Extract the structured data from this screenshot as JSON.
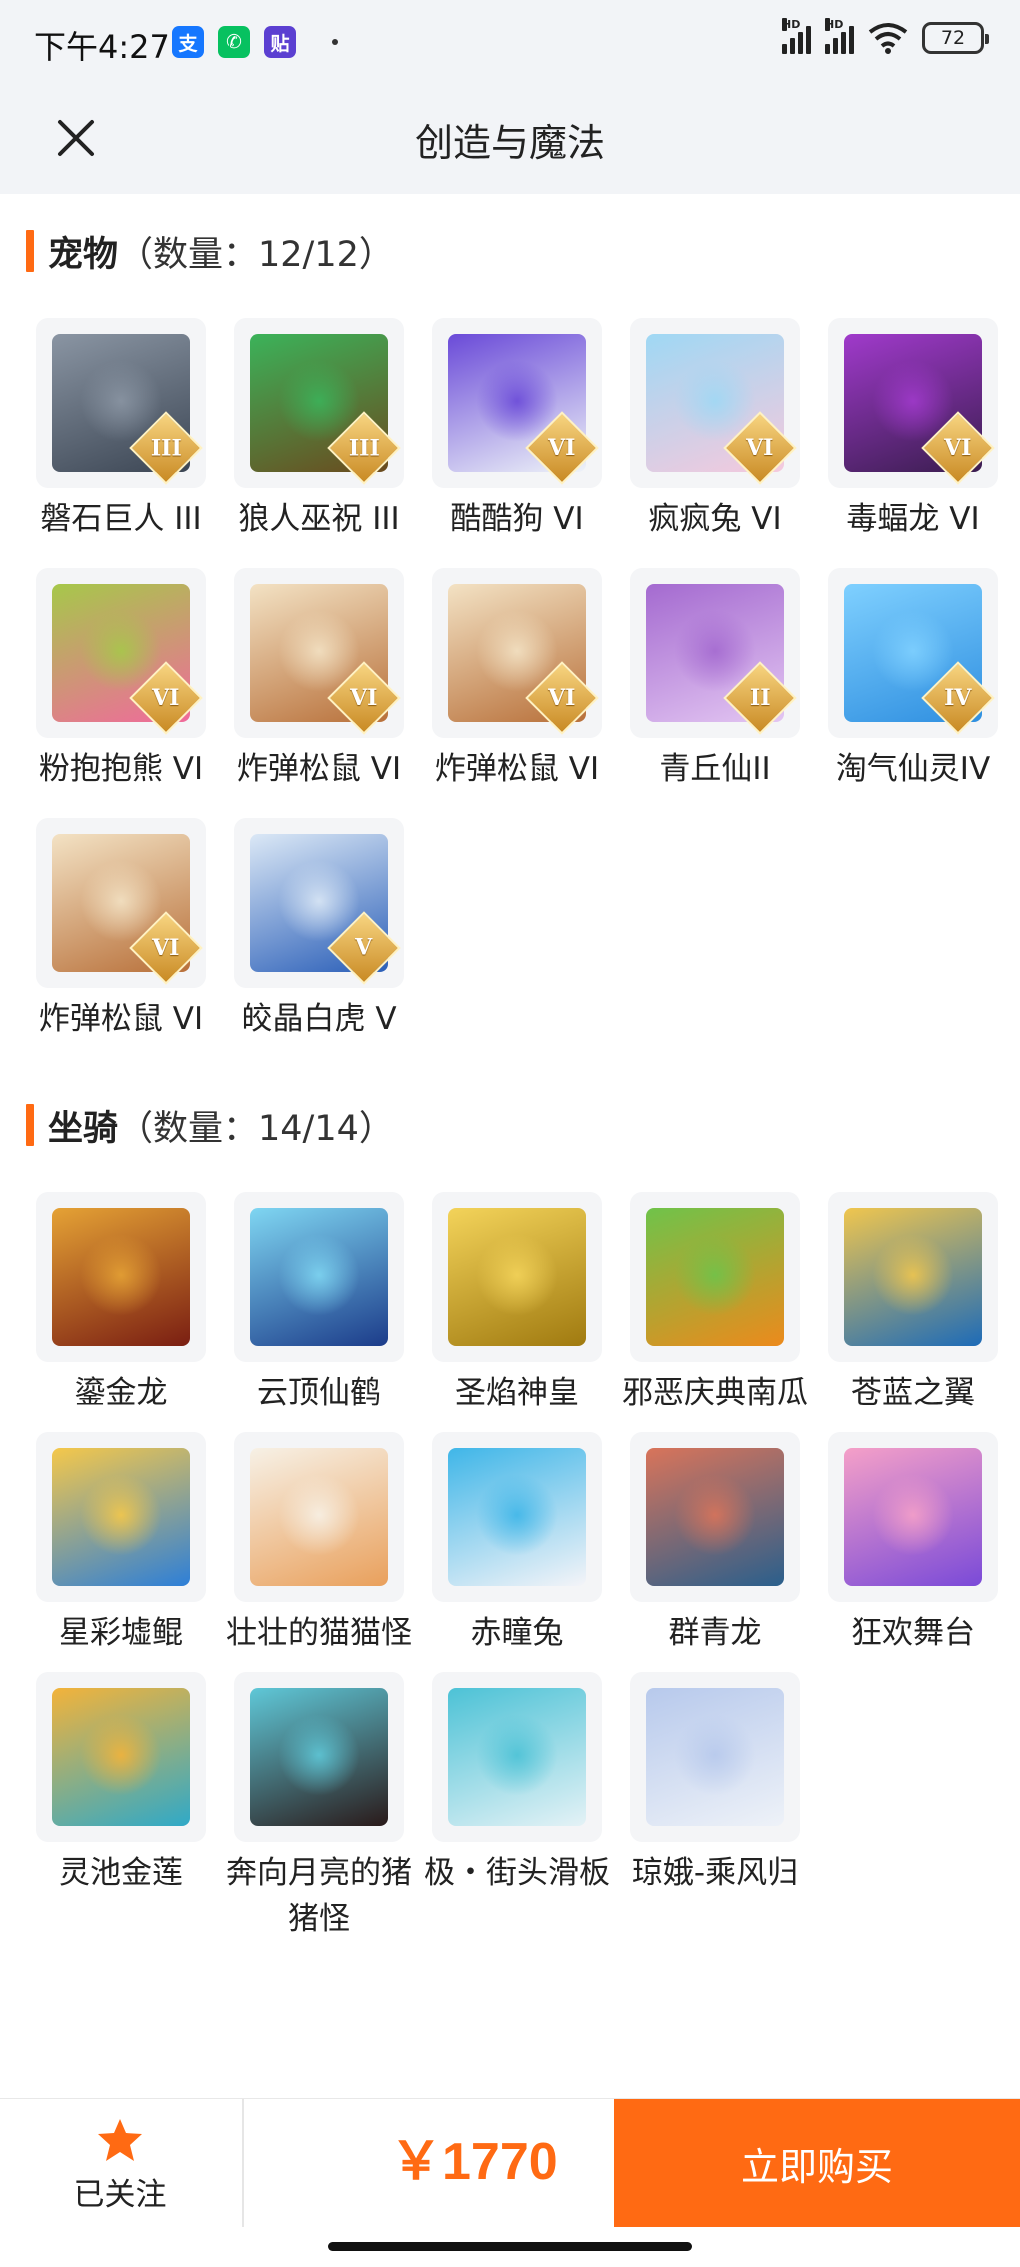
{
  "status": {
    "time": "下午4:27",
    "battery": "72",
    "apps": [
      {
        "icon": "alipay-icon",
        "glyph": "支",
        "color": "#1677ff"
      },
      {
        "icon": "wechat-icon",
        "glyph": "✆",
        "color": "#07c160"
      },
      {
        "icon": "tieba-icon",
        "glyph": "贴",
        "color": "#5b3fd1"
      }
    ],
    "signal_label": "HD"
  },
  "header": {
    "title": "创造与魔法",
    "close_icon": "close-icon"
  },
  "pets": {
    "name": "宠物",
    "count": "（数量：12/12）",
    "items": [
      {
        "name": "磐石巨人 III",
        "badge": "III",
        "color1": "#3c4654",
        "color2": "#8a95a3"
      },
      {
        "name": "狼人巫祝 III",
        "badge": "III",
        "color1": "#6b4a1e",
        "color2": "#3bb35a"
      },
      {
        "name": "酷酷狗 VI",
        "badge": "VI",
        "color1": "#eef3f8",
        "color2": "#6a4ad8"
      },
      {
        "name": "疯疯兔 VI",
        "badge": "VI",
        "color1": "#f5c9dd",
        "color2": "#9fd8f4"
      },
      {
        "name": "毒蝠龙 VI",
        "badge": "VI",
        "color1": "#3a1d4f",
        "color2": "#a03acb"
      },
      {
        "name": "粉抱抱熊 VI",
        "badge": "VI",
        "color1": "#f06a9c",
        "color2": "#a6c84a"
      },
      {
        "name": "炸弹松鼠 VI",
        "badge": "VI",
        "color1": "#b8703a",
        "color2": "#f3e2c4"
      },
      {
        "name": "炸弹松鼠 VI",
        "badge": "VI",
        "color1": "#b8703a",
        "color2": "#f3e2c4"
      },
      {
        "name": "青丘仙II",
        "badge": "II",
        "color1": "#e3c6f2",
        "color2": "#a46ad0"
      },
      {
        "name": "淘气仙灵IV",
        "badge": "IV",
        "color1": "#2f8fe0",
        "color2": "#7fd0ff"
      },
      {
        "name": "炸弹松鼠 VI",
        "badge": "VI",
        "color1": "#b8703a",
        "color2": "#f3e2c4"
      },
      {
        "name": "皎晶白虎 V",
        "badge": "V",
        "color1": "#2b5fb8",
        "color2": "#dbe8f6"
      }
    ]
  },
  "mounts": {
    "name": "坐骑",
    "count": "（数量：14/14）",
    "items": [
      {
        "name": "鎏金龙",
        "color1": "#7a1e12",
        "color2": "#e5a235"
      },
      {
        "name": "云顶仙鹤",
        "color1": "#1c3c8a",
        "color2": "#7fd6f2"
      },
      {
        "name": "圣焰神皇",
        "color1": "#a07a10",
        "color2": "#f3d35a"
      },
      {
        "name": "邪恶庆典南瓜",
        "color1": "#ec8a1c",
        "color2": "#6fc34a"
      },
      {
        "name": "苍蓝之翼",
        "color1": "#1d6bb8",
        "color2": "#f0c64e"
      },
      {
        "name": "星彩墟鲲",
        "color1": "#2d7fd8",
        "color2": "#f5c84a"
      },
      {
        "name": "壮壮的猫猫怪",
        "color1": "#e9a05c",
        "color2": "#f7f1e6"
      },
      {
        "name": "赤瞳兔",
        "color1": "#f4f4f8",
        "color2": "#3fb6e8"
      },
      {
        "name": "群青龙",
        "color1": "#2a5f8c",
        "color2": "#d9745a"
      },
      {
        "name": "狂欢舞台",
        "color1": "#7a4ad8",
        "color2": "#f5a0c8"
      },
      {
        "name": "灵池金莲",
        "color1": "#2fa9c8",
        "color2": "#f3b33a"
      },
      {
        "name": "奔向月亮的猪猪怪",
        "color1": "#2a1a1a",
        "color2": "#5fc8d8"
      },
      {
        "name": "极・街头滑板",
        "color1": "#e4f2f6",
        "color2": "#4cc2d6"
      },
      {
        "name": "琼娥-乘风归",
        "color1": "#eef2f8",
        "color2": "#b7c9ec"
      }
    ]
  },
  "bottom": {
    "follow_label": "已关注",
    "follow_icon": "star-icon",
    "price": "￥1770",
    "buy_label": "立即购买",
    "accent": "#ff6a13"
  }
}
